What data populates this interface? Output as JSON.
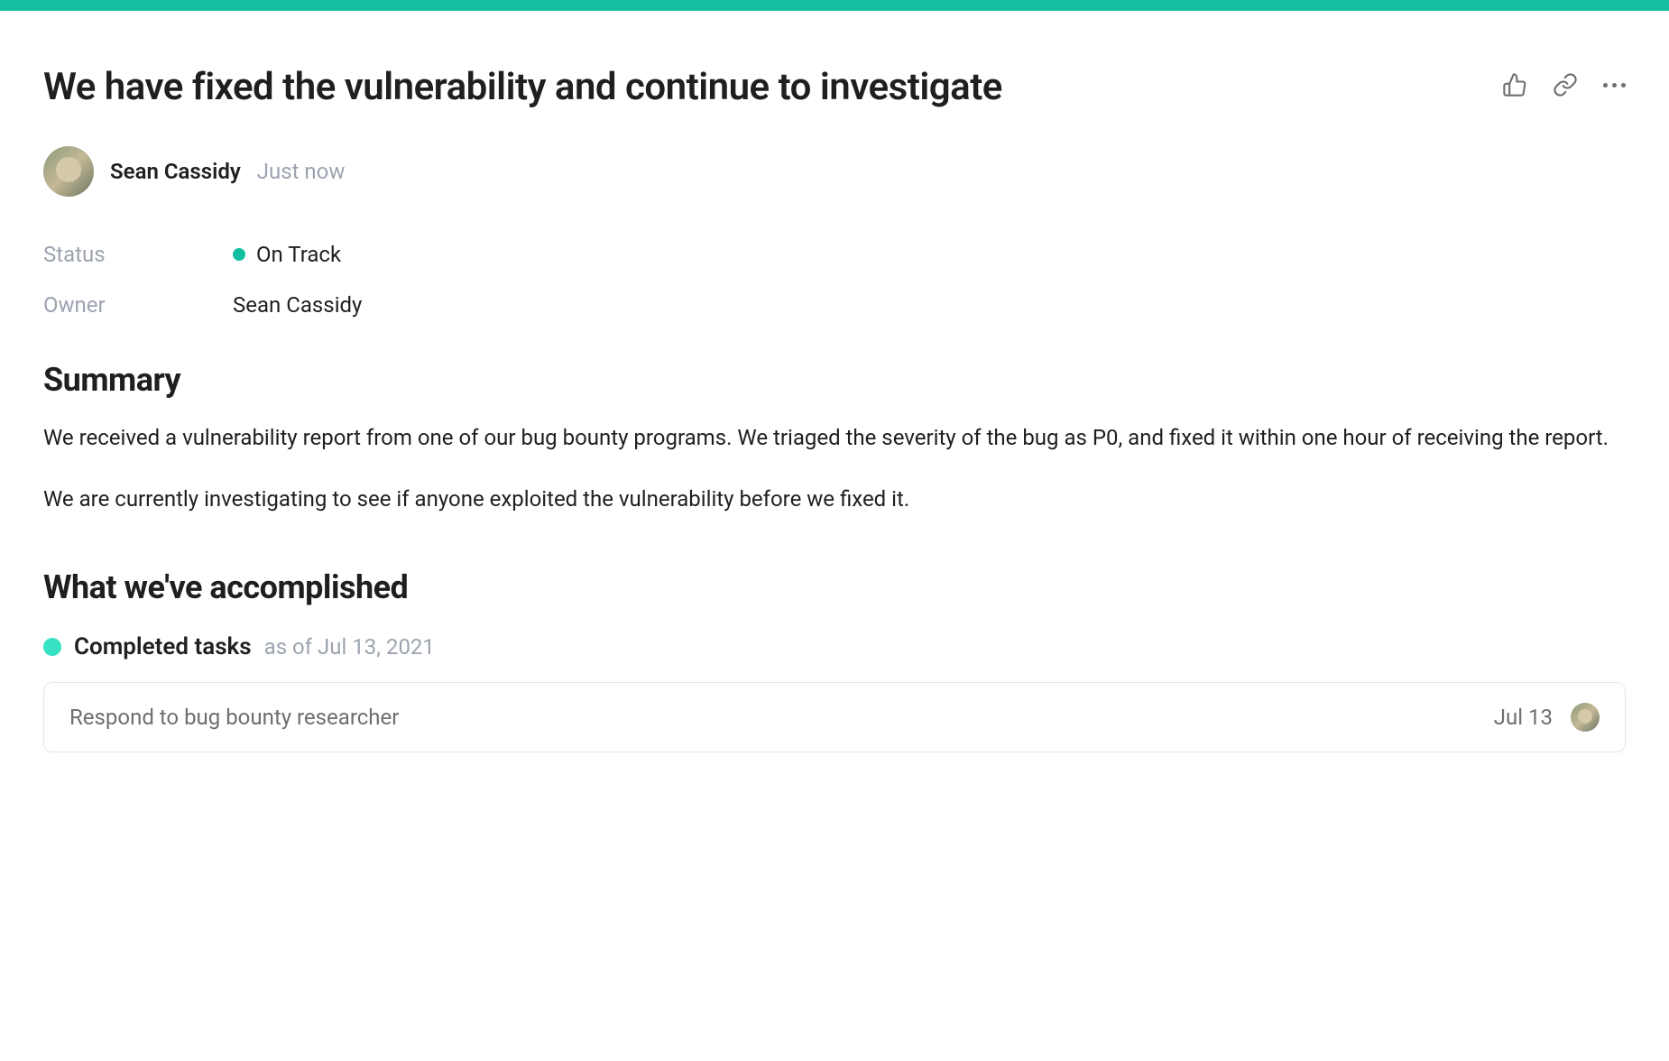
{
  "page": {
    "title": "We have fixed the vulnerability and continue to investigate"
  },
  "author": {
    "name": "Sean Cassidy",
    "timestamp": "Just now"
  },
  "meta": {
    "status_label": "Status",
    "status_value": "On Track",
    "owner_label": "Owner",
    "owner_value": "Sean Cassidy"
  },
  "summary": {
    "heading": "Summary",
    "paragraph1": "We received a vulnerability report from one of our bug bounty programs. We triaged the severity of the bug as P0, and fixed it within one hour of receiving the report.",
    "paragraph2": "We are currently investigating to see if anyone exploited the vulnerability before we fixed it."
  },
  "accomplished": {
    "heading": "What we've accomplished",
    "completed_label": "Completed tasks",
    "completed_date": "as of Jul 13, 2021"
  },
  "tasks": [
    {
      "title": "Respond to bug bounty researcher",
      "date": "Jul 13"
    }
  ],
  "colors": {
    "accent": "#14bfa1"
  }
}
